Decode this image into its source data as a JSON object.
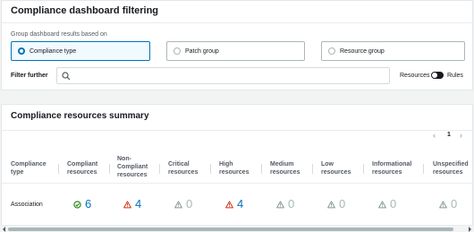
{
  "filtering": {
    "title": "Compliance dashboard filtering",
    "group_label": "Group dashboard results based on",
    "options": [
      {
        "label": "Compliance type",
        "selected": true
      },
      {
        "label": "Patch group",
        "selected": false
      },
      {
        "label": "Resource group",
        "selected": false
      }
    ],
    "filter_label": "Filter further",
    "search_placeholder": "",
    "toggle": {
      "left_label": "Resources",
      "right_label": "Rules",
      "state": "rules"
    }
  },
  "summary": {
    "title": "Compliance resources summary",
    "pagination": {
      "prev": "‹",
      "page": "1",
      "next": "›"
    },
    "columns": [
      "Compliance\ntype",
      "Compliant\nresources",
      "Non-\nCompliant\nresources",
      "Critical\nresources",
      "High\nresources",
      "Medium\nresources",
      "Low\nresources",
      "Informational\nresources",
      "Unspecified\nresources"
    ],
    "rows": [
      {
        "name": "Association",
        "cells": [
          {
            "icon": "check-circle-icon",
            "value": "6",
            "color": "#1d8102",
            "num_color": "blue"
          },
          {
            "icon": "warning-icon",
            "value": "4",
            "color": "#d13212",
            "num_color": "blue"
          },
          {
            "icon": "warning-icon",
            "value": "0",
            "color": "#879596",
            "num_color": "grey"
          },
          {
            "icon": "warning-icon",
            "value": "4",
            "color": "#d13212",
            "num_color": "blue"
          },
          {
            "icon": "warning-icon",
            "value": "0",
            "color": "#879596",
            "num_color": "grey"
          },
          {
            "icon": "warning-icon",
            "value": "0",
            "color": "#879596",
            "num_color": "grey"
          },
          {
            "icon": "warning-icon",
            "value": "0",
            "color": "#879596",
            "num_color": "grey"
          },
          {
            "icon": "warning-icon",
            "value": "0",
            "color": "#879596",
            "num_color": "grey"
          }
        ]
      }
    ]
  },
  "colors": {
    "accent": "#0073bb",
    "success": "#1d8102",
    "error": "#d13212",
    "muted": "#879596"
  }
}
